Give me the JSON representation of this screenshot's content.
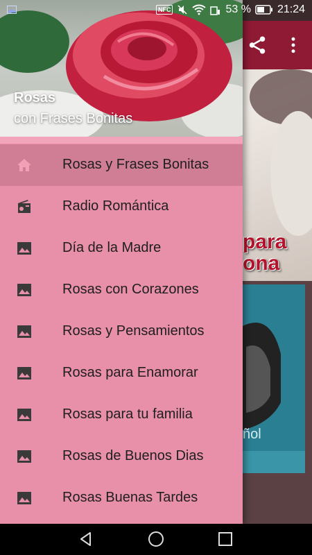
{
  "status_bar": {
    "nfc": "NFC",
    "battery_percent": "53 %",
    "time": "21:24"
  },
  "drawer": {
    "header": {
      "title": "Rosas",
      "subtitle": "con Frases Bonitas"
    },
    "items": [
      {
        "label": "Rosas y Frases Bonitas",
        "icon": "home-icon",
        "active": true
      },
      {
        "label": "Radio Romántica",
        "icon": "radio-icon",
        "active": false
      },
      {
        "label": "Día de la Madre",
        "icon": "image-icon",
        "active": false
      },
      {
        "label": "Rosas con Corazones",
        "icon": "image-icon",
        "active": false
      },
      {
        "label": "Rosas y Pensamientos",
        "icon": "image-icon",
        "active": false
      },
      {
        "label": "Rosas para Enamorar",
        "icon": "image-icon",
        "active": false
      },
      {
        "label": "Rosas para tu familia",
        "icon": "image-icon",
        "active": false
      },
      {
        "label": "Rosas de Buenos Dias",
        "icon": "image-icon",
        "active": false
      },
      {
        "label": "Rosas Buenas Tardes",
        "icon": "image-icon",
        "active": false
      }
    ]
  },
  "background": {
    "hero_text_1": "para",
    "hero_text_2": "ona",
    "card_text": "ñol"
  },
  "colors": {
    "drawer_bg": "#e88fa9",
    "active_item_bg": "#d07d96",
    "app_bar": "#8e1a34",
    "icon": "#3a3a3a"
  }
}
